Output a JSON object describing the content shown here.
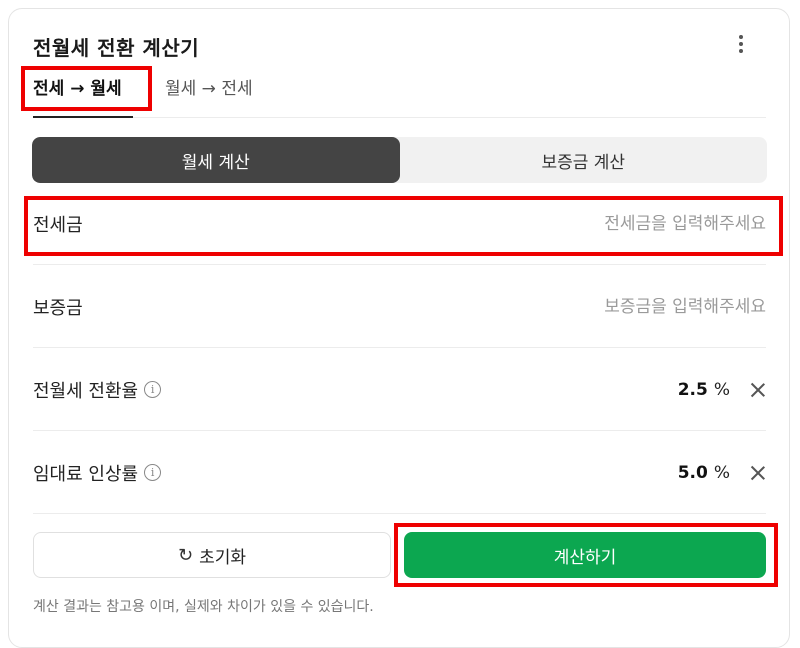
{
  "card": {
    "title": "전월세 전환 계산기"
  },
  "tabs": [
    {
      "label": "전세 → 월세",
      "active": true
    },
    {
      "label": "월세 → 전세",
      "active": false
    }
  ],
  "segment": {
    "monthly_label": "월세 계산",
    "deposit_label": "보증금 계산",
    "selected": "월세 계산"
  },
  "fields": {
    "jeonse": {
      "label": "전세금",
      "placeholder": "전세금을 입력해주세요",
      "value": ""
    },
    "deposit": {
      "label": "보증금",
      "placeholder": "보증금을 입력해주세요",
      "value": ""
    },
    "conversion_rate": {
      "label": "전월세 전환율",
      "value": "2.5",
      "unit": "%"
    },
    "rent_increase": {
      "label": "임대료 인상률",
      "value": "5.0",
      "unit": "%"
    }
  },
  "buttons": {
    "reset_label": "초기화",
    "calculate_label": "계산하기"
  },
  "disclaimer": "계산 결과는 참고용 이며, 실제와 차이가 있을 수 있습니다.",
  "icons": {
    "more": "more-vertical-icon",
    "info": "info-icon",
    "clear": "close-icon",
    "reset": "refresh-icon"
  },
  "colors": {
    "accent_green": "#0ca750",
    "segment_active": "#444444",
    "highlight_red": "#ee0000"
  }
}
